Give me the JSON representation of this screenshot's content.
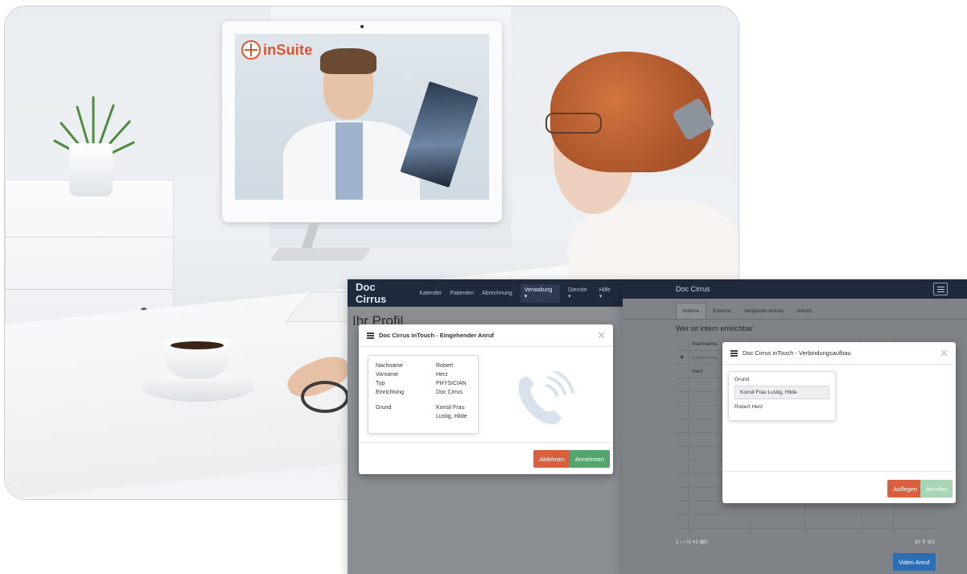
{
  "hero": {
    "logo_text": "inSuite",
    "brand_color": "#e4522d"
  },
  "left_app": {
    "brand": "Doc Cirrus",
    "nav": [
      "Kalender",
      "Patienten",
      "Abrechnung",
      "Verwaltung ▾",
      "Dienste ▾",
      "Hilfe ▾"
    ],
    "active_nav": "Verwaltung ▾",
    "page_title": "Ihr Profil",
    "modal": {
      "title": "Doc Cirrus inTouch - Eingehender Anruf",
      "rows": [
        {
          "k": "Nachname",
          "v": "Robert"
        },
        {
          "k": "Vorname",
          "v": "Herz"
        },
        {
          "k": "Typ",
          "v": "PHYSICIAN"
        },
        {
          "k": "Einrichtung",
          "v": "Doc Cirrus"
        }
      ],
      "grund_label": "Grund",
      "grund_value_1": "Konsil Frau",
      "grund_value_2": "Lustig, Hilde",
      "decline": "Ablehnen",
      "accept": "Annehmen",
      "icon": "phone-ringing-icon"
    }
  },
  "right_app": {
    "brand": "Doc Cirrus",
    "tabs": [
      "Interne",
      "Externe",
      "Verpasste Anrufe",
      "Anrufe"
    ],
    "active_tab": "Interne",
    "section_title": "Wer ist intern erreichbar",
    "col_header": "Nachname",
    "filter_placeholder": "Nachname",
    "first_row": "Herz",
    "pager_text": "1  ‹  ›  /1  ≡1  ⊞0",
    "page_size": "10 ⇕  ⊟1",
    "video_call": "Video Anruf",
    "modal": {
      "title": "Doc Cirrus inTouch - Verbindungsaufbau",
      "grund_label": "Grund",
      "grund_value": "Konsil Frau Lustig, Hilde",
      "person": "Robert Herz",
      "hangup": "Auflegen",
      "call": "Anrufen"
    }
  }
}
